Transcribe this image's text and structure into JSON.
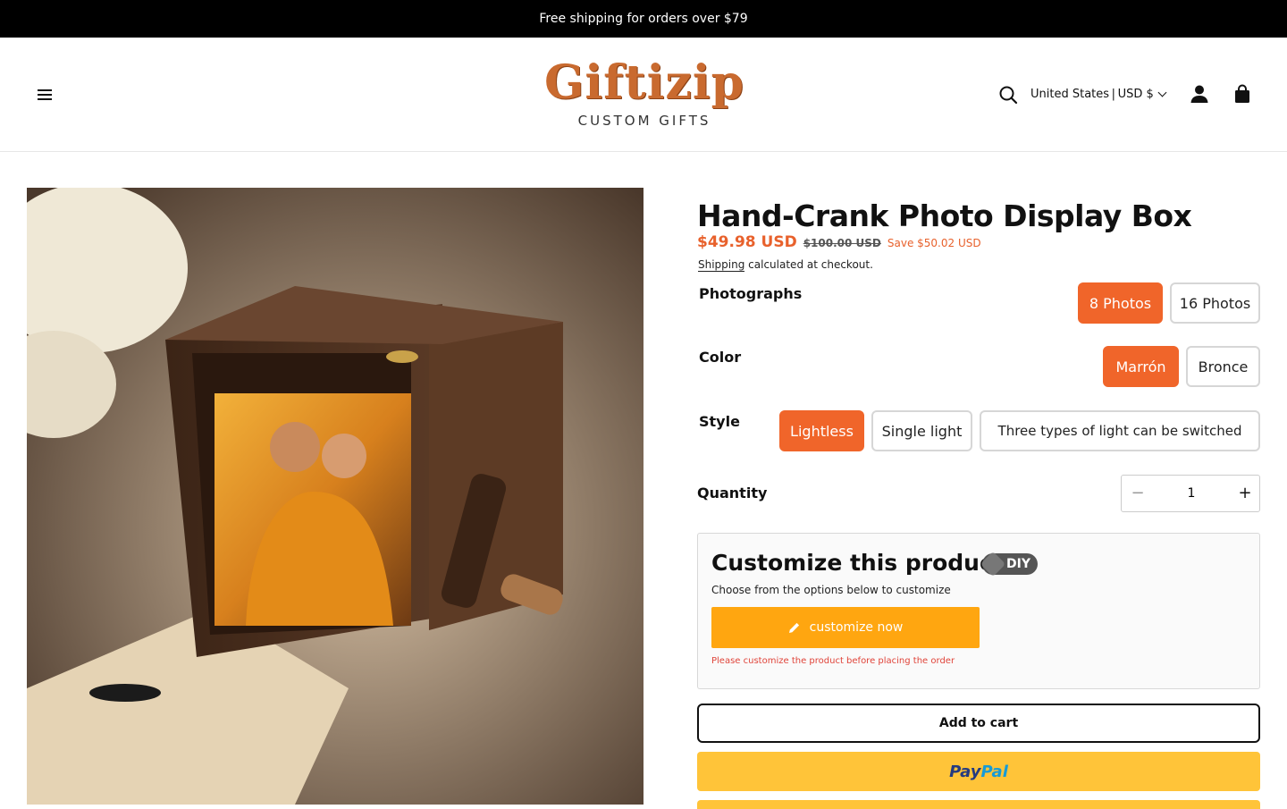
{
  "announcement": "Free shipping for orders over $79",
  "header": {
    "logo_word": "Giftizip",
    "logo_sub": "CUSTOM GIFTS",
    "currency": "United States | USD $"
  },
  "product": {
    "title": "Hand-Crank Photo Display Box",
    "price": "$49.98 USD",
    "compare_price": "$100.00 USD",
    "save": "Save $50.02 USD",
    "shipping_link": "Shipping",
    "shipping_text": " calculated at checkout.",
    "options": [
      {
        "label": "Photographs",
        "values": [
          "8 Photos",
          "16 Photos"
        ],
        "selected": "8 Photos"
      },
      {
        "label": "Color",
        "values": [
          "Marrón",
          "Bronce"
        ],
        "selected": "Marrón"
      },
      {
        "label": "Style",
        "values": [
          "Lightless",
          "Single light",
          "Three types of light can be switched"
        ],
        "selected": "Lightless"
      }
    ],
    "quantity_label": "Quantity",
    "quantity": "1",
    "quantity_minus": "−",
    "quantity_plus": "+"
  },
  "customize": {
    "title": "Customize this product",
    "badge": "DIY",
    "subtitle": "Choose from the options below to customize",
    "button": "customize now",
    "warning": "Please customize the product before placing the order"
  },
  "actions": {
    "add_to_cart": "Add to cart",
    "paypal_a": "Pay",
    "paypal_b": "Pal"
  },
  "colors": {
    "accent": "#f0652a",
    "price": "#e8612c",
    "customize_button": "#ffa610",
    "paypal": "#ffc439",
    "logo": "#c96a2f"
  }
}
